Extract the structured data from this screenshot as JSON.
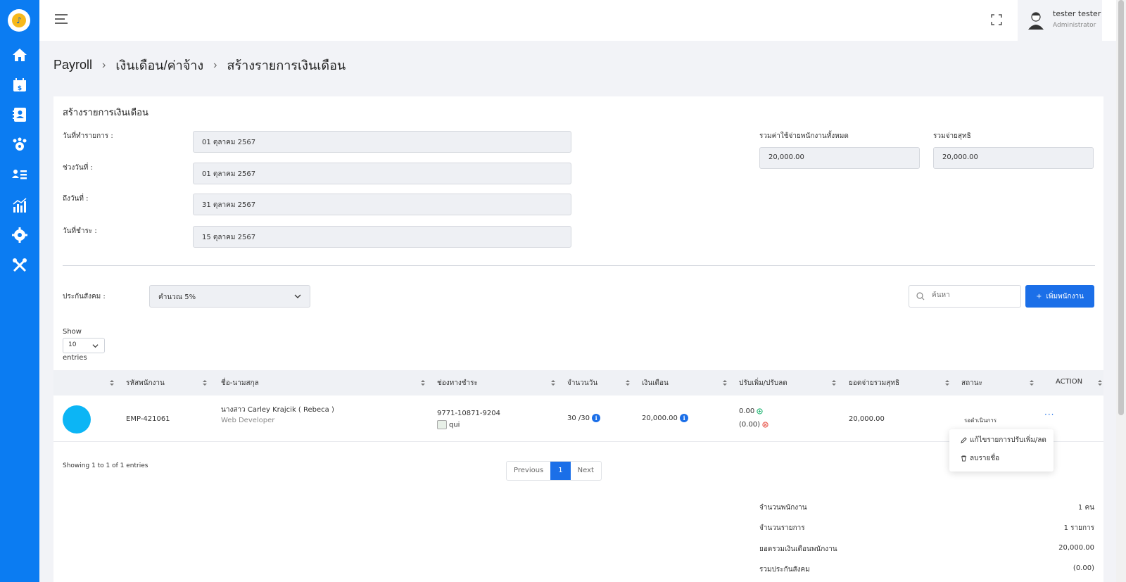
{
  "header": {
    "user_name": "tester tester",
    "user_role": "Administrator"
  },
  "breadcrumb": [
    "Payroll",
    "เงินเดือน/ค่าจ้าง",
    "สร้างรายการเงินเดือน"
  ],
  "form": {
    "title": "สร้างรายการเงินเดือน",
    "fields": [
      {
        "label": "วันที่ทำรายการ :",
        "value": "01 ตุลาคม 2567"
      },
      {
        "label": "ช่วงวันที่ :",
        "value": "01 ตุลาคม 2567"
      },
      {
        "label": "ถึงวันที่ :",
        "value": "31 ตุลาคม 2567"
      },
      {
        "label": "วันที่ชำระ :",
        "value": "15 ตุลาคม 2567"
      }
    ],
    "total_expense_label": "รวมค่าใช้จ่ายพนักงานทั้งหมด",
    "total_expense_value": "20,000.00",
    "net_pay_label": "รวมจ่ายสุทธิ",
    "net_pay_value": "20,000.00"
  },
  "controls": {
    "social_security_label": "ประกันสังคม :",
    "social_security_value": "คำนวณ 5%",
    "search_placeholder": "ค้นหา",
    "add_employee_label": "เพิ่มพนักงาน",
    "show_label": "Show",
    "show_value": "10",
    "entries_label": "entries"
  },
  "table": {
    "columns": [
      "รหัสพนักงาน",
      "ชื่อ-นามสกุล",
      "ช่องทางชำระ",
      "จำนวนวัน",
      "เงินเดือน",
      "ปรับเพิ่ม/ปรับลด",
      "ยอดจ่ายรวมสุทธิ",
      "สถานะ",
      "ACTION"
    ],
    "rows": [
      {
        "emp_code": "EMP-421061",
        "name": "นางสาว Carley Krajcik ( Rebeca )",
        "position": "Web Developer",
        "account": "9771-10871-9204",
        "bank": "qui",
        "days": "30 /30",
        "salary": "20,000.00",
        "adjust_plus": "0.00",
        "adjust_minus": "(0.00)",
        "net": "20,000.00",
        "status": "รอดำเนินการ"
      }
    ],
    "action_menu": [
      "แก้ไขรายการปรับเพิ่ม/ลด",
      "ลบรายชื่อ"
    ],
    "showing_text": "Showing 1 to 1 of 1 entries",
    "pager": {
      "previous": "Previous",
      "current": "1",
      "next": "Next"
    }
  },
  "summary": [
    {
      "label": "จำนวนพนักงาน",
      "value": "1 คน"
    },
    {
      "label": "จำนวนรายการ",
      "value": "1 รายการ"
    },
    {
      "label": "ยอดรวมเงินเดือนพนักงาน",
      "value": "20,000.00"
    },
    {
      "label": "รวมประกันสังคม",
      "value": "(0.00)"
    }
  ],
  "colors": {
    "sidebar": "#0b7cf2",
    "primary": "#1b6fe8",
    "avatar": "#0cb5f5"
  }
}
